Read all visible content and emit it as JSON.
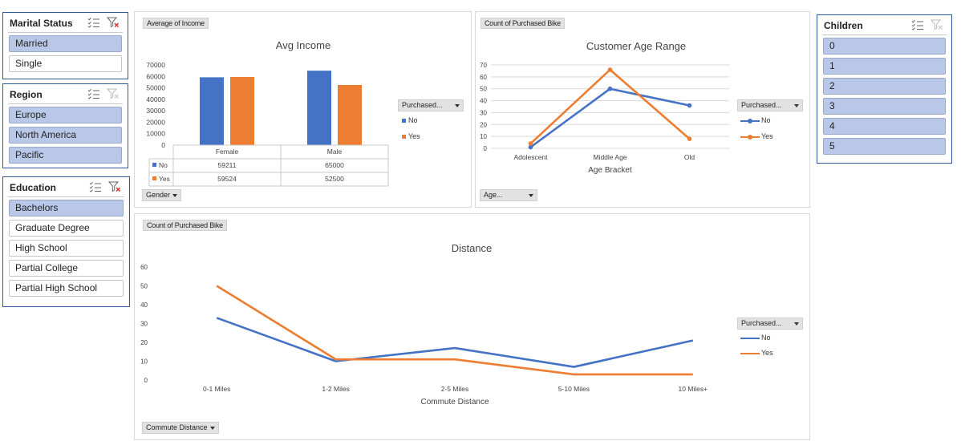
{
  "colors": {
    "no": "#4472c4",
    "yes": "#ed7d31",
    "selected": "#b9c8e8",
    "border": "#2e5b9a"
  },
  "icons": {
    "multi_select": "multi-select-icon",
    "clear_filter": "clear-filter-icon"
  },
  "slicers": {
    "marital": {
      "title": "Marital Status",
      "items": [
        {
          "label": "Married",
          "selected": true
        },
        {
          "label": "Single",
          "selected": false
        }
      ]
    },
    "region": {
      "title": "Region",
      "items": [
        {
          "label": "Europe",
          "selected": true
        },
        {
          "label": "North America",
          "selected": true
        },
        {
          "label": "Pacific",
          "selected": true
        }
      ]
    },
    "education": {
      "title": "Education",
      "items": [
        {
          "label": "Bachelors",
          "selected": true
        },
        {
          "label": "Graduate Degree",
          "selected": false
        },
        {
          "label": "High School",
          "selected": false
        },
        {
          "label": "Partial College",
          "selected": false
        },
        {
          "label": "Partial High School",
          "selected": false
        }
      ]
    },
    "children": {
      "title": "Children",
      "items": [
        {
          "label": "0",
          "selected": true
        },
        {
          "label": "1",
          "selected": true
        },
        {
          "label": "2",
          "selected": true
        },
        {
          "label": "3",
          "selected": true
        },
        {
          "label": "4",
          "selected": true
        },
        {
          "label": "5",
          "selected": true
        }
      ]
    }
  },
  "income": {
    "field_button": "Average of Income",
    "axis_button": "Gender",
    "legend_button": "Purchased...",
    "legend": [
      "No",
      "Yes"
    ]
  },
  "age": {
    "field_button": "Count of Purchased Bike",
    "axis_button": "Age...",
    "legend_button": "Purchased...",
    "legend": [
      "No",
      "Yes"
    ]
  },
  "distance": {
    "field_button": "Count of Purchased Bike",
    "axis_button": "Commute Distance",
    "legend_button": "Purchased...",
    "legend": [
      "No",
      "Yes"
    ]
  },
  "chart_data": [
    {
      "type": "bar",
      "title": "Avg Income",
      "categories": [
        "Female",
        "Male"
      ],
      "series": [
        {
          "name": "No",
          "values": [
            59211,
            65000
          ]
        },
        {
          "name": "Yes",
          "values": [
            59524,
            52500
          ]
        }
      ],
      "yticks": [
        "0",
        "10000",
        "20000",
        "30000",
        "40000",
        "50000",
        "60000",
        "70000"
      ],
      "ylim": [
        0,
        70000
      ],
      "table": {
        "rows": [
          {
            "name": "No",
            "values": [
              "59211",
              "65000"
            ]
          },
          {
            "name": "Yes",
            "values": [
              "59524",
              "52500"
            ]
          }
        ]
      }
    },
    {
      "type": "line",
      "title": "Customer Age Range",
      "xlabel": "Age Bracket",
      "categories": [
        "Adolescent",
        "Middle Age",
        "Old"
      ],
      "series": [
        {
          "name": "No",
          "values": [
            1,
            50,
            36
          ]
        },
        {
          "name": "Yes",
          "values": [
            4,
            66,
            8
          ]
        }
      ],
      "yticks": [
        "0",
        "10",
        "20",
        "30",
        "40",
        "50",
        "60",
        "70"
      ],
      "ylim": [
        0,
        70
      ],
      "grid": true
    },
    {
      "type": "line",
      "title": "Distance",
      "xlabel": "Commute Distance",
      "categories": [
        "0-1 Miles",
        "1-2 Miles",
        "2-5 Miles",
        "5-10 Miles",
        "10 Miles+"
      ],
      "series": [
        {
          "name": "No",
          "values": [
            33,
            10,
            17,
            7,
            21
          ]
        },
        {
          "name": "Yes",
          "values": [
            50,
            11,
            11,
            3,
            3
          ]
        }
      ],
      "yticks": [
        "0",
        "10",
        "20",
        "30",
        "40",
        "50",
        "60"
      ],
      "ylim": [
        0,
        60
      ],
      "grid": false
    }
  ]
}
